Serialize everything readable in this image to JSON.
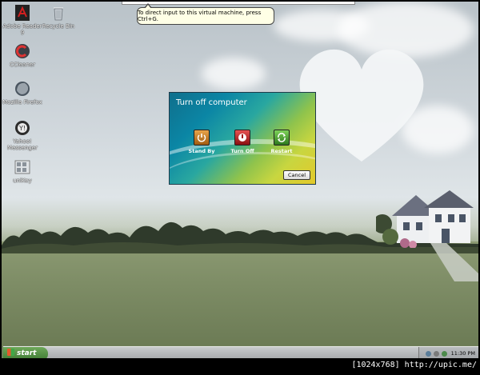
{
  "desktop_icons": [
    {
      "label": "Adobe Reader 9",
      "icon": "adobe-reader-icon"
    },
    {
      "label": "Recycle Bin",
      "icon": "recycle-bin-icon"
    },
    {
      "label": "CCleaner",
      "icon": "ccleaner-icon"
    },
    {
      "label": "Mozilla Firefox",
      "icon": "firefox-icon"
    },
    {
      "label": "Yahoo! Messenger",
      "icon": "yahoo-messenger-icon"
    },
    {
      "label": "uniKey",
      "icon": "unikey-icon"
    }
  ],
  "vm_tooltip": {
    "text": "To direct input to this virtual machine, press Ctrl+G."
  },
  "shutdown_dialog": {
    "title": "Turn off computer",
    "buttons": [
      {
        "label": "Stand By",
        "color": "#c77a1a"
      },
      {
        "label": "Turn Off",
        "color": "#b51f1f"
      },
      {
        "label": "Restart",
        "color": "#3e9a2a"
      }
    ],
    "cancel_label": "Cancel"
  },
  "taskbar": {
    "start_label": "start",
    "clock": "11:30 PM"
  },
  "watermark": "[1024x768] http://upic.me/"
}
